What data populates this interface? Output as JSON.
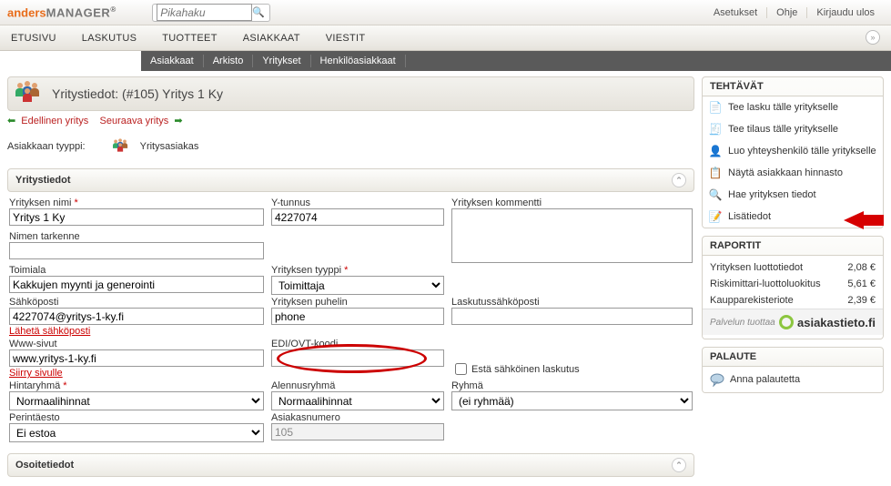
{
  "header": {
    "logo_prefix": "anders",
    "logo_suffix": "MANAGER",
    "search_placeholder": "Pikahaku",
    "links": [
      "Asetukset",
      "Ohje",
      "Kirjaudu ulos"
    ]
  },
  "nav": [
    "ETUSIVU",
    "LASKUTUS",
    "TUOTTEET",
    "ASIAKKAAT",
    "VIESTIT"
  ],
  "subnav": [
    "Asiakkaat",
    "Arkisto",
    "Yritykset",
    "Henkilöasiakkaat"
  ],
  "page_title": "Yritystiedot: (#105) Yritys 1 Ky",
  "nav_prev": "Edellinen yritys",
  "nav_next": "Seuraava yritys",
  "customer_type_label": "Asiakkaan tyyppi:",
  "customer_type_value": "Yritysasiakas",
  "section1_title": "Yritystiedot",
  "section2_title": "Osoitetiedot",
  "form": {
    "yrityksen_nimi_label": "Yrityksen nimi",
    "yrityksen_nimi_value": "Yritys 1 Ky",
    "y_tunnus_label": "Y-tunnus",
    "y_tunnus_value": "4227074",
    "kommentti_label": "Yrityksen kommentti",
    "nimen_tarkenne_label": "Nimen tarkenne",
    "nimen_tarkenne_value": "",
    "toimiala_label": "Toimiala",
    "toimiala_value": "Kakkujen myynti ja generointi",
    "yrityksen_tyyppi_label": "Yrityksen tyyppi",
    "yrityksen_tyyppi_value": "Toimittaja",
    "sahkoposti_label": "Sähköposti",
    "sahkoposti_value": "4227074@yritys-1-ky.fi",
    "laheta_link": "Lähetä sähköposti",
    "puhelin_label": "Yrityksen puhelin",
    "puhelin_value": "phone",
    "laskutussposti_label": "Laskutussähköposti",
    "laskutussposti_value": "",
    "www_label": "Www-sivut",
    "www_value": "www.yritys-1-ky.fi",
    "siirry_link": "Siirry sivulle",
    "edi_label": "EDI/OVT-koodi",
    "edi_value": "",
    "esta_label": "Estä sähköinen laskutus",
    "hintaryhma_label": "Hintaryhmä",
    "hintaryhma_value": "Normaalihinnat",
    "alennusryhma_label": "Alennusryhmä",
    "alennusryhma_value": "Normaalihinnat",
    "ryhma_label": "Ryhmä",
    "ryhma_value": "(ei ryhmää)",
    "perintaesto_label": "Perintäesto",
    "perintaesto_value": "Ei estoa",
    "asiakasnumero_label": "Asiakasnumero",
    "asiakasnumero_value": "105"
  },
  "tehtavat": {
    "title": "TEHTÄVÄT",
    "items": [
      "Tee lasku tälle yritykselle",
      "Tee tilaus tälle yritykselle",
      "Luo yhteyshenkilö tälle yritykselle",
      "Näytä asiakkaan hinnasto",
      "Hae yrityksen tiedot",
      "Lisätiedot"
    ]
  },
  "raportit": {
    "title": "RAPORTIT",
    "rows": [
      {
        "label": "Yrityksen luottotiedot",
        "price": "2,08 €"
      },
      {
        "label": "Riskimittari-luottoluokitus",
        "price": "5,61 €"
      },
      {
        "label": "Kaupparekisteriote",
        "price": "2,39 €"
      }
    ],
    "provider_label": "Palvelun tuottaa",
    "provider_name": "asiakastieto.fi"
  },
  "palaute": {
    "title": "PALAUTE",
    "link": "Anna palautetta"
  }
}
